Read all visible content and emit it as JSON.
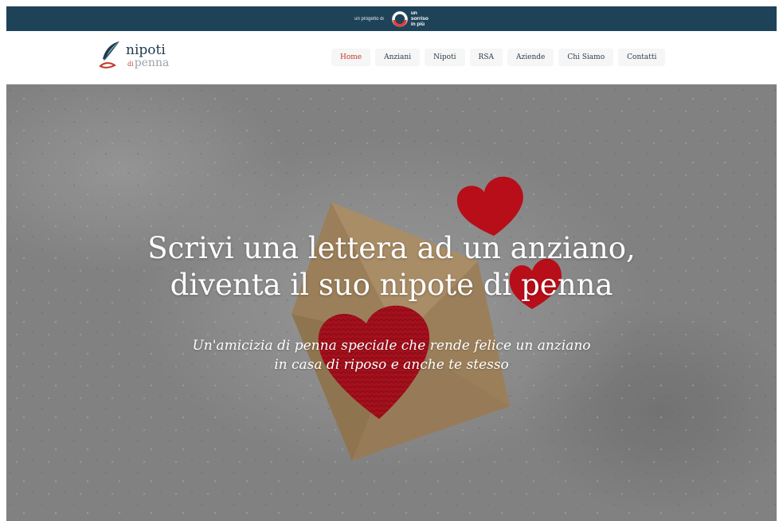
{
  "topbar": {
    "prefix": "un progetto di",
    "partner_line1": "un",
    "partner_line2": "sorriso",
    "partner_line3": "in più",
    "bg": "#1e4358"
  },
  "brand": {
    "name": "nipoti",
    "sub_di": "di",
    "sub": "penna",
    "icon": "quill-icon"
  },
  "menu": [
    {
      "label": "Home",
      "active": true
    },
    {
      "label": "Anziani"
    },
    {
      "label": "Nipoti"
    },
    {
      "label": "RSA"
    },
    {
      "label": "Aziende"
    },
    {
      "label": "Chi Siamo"
    },
    {
      "label": "Contatti"
    }
  ],
  "hero": {
    "title_line1": "Scrivi una lettera ad un anziano,",
    "title_line2": "diventa il suo nipote di penna",
    "sub_line1": "Un'amicizia di penna speciale che rende felice un anziano",
    "sub_line2": "in casa di riposo e anche te stesso",
    "accent": "#c0392b"
  }
}
